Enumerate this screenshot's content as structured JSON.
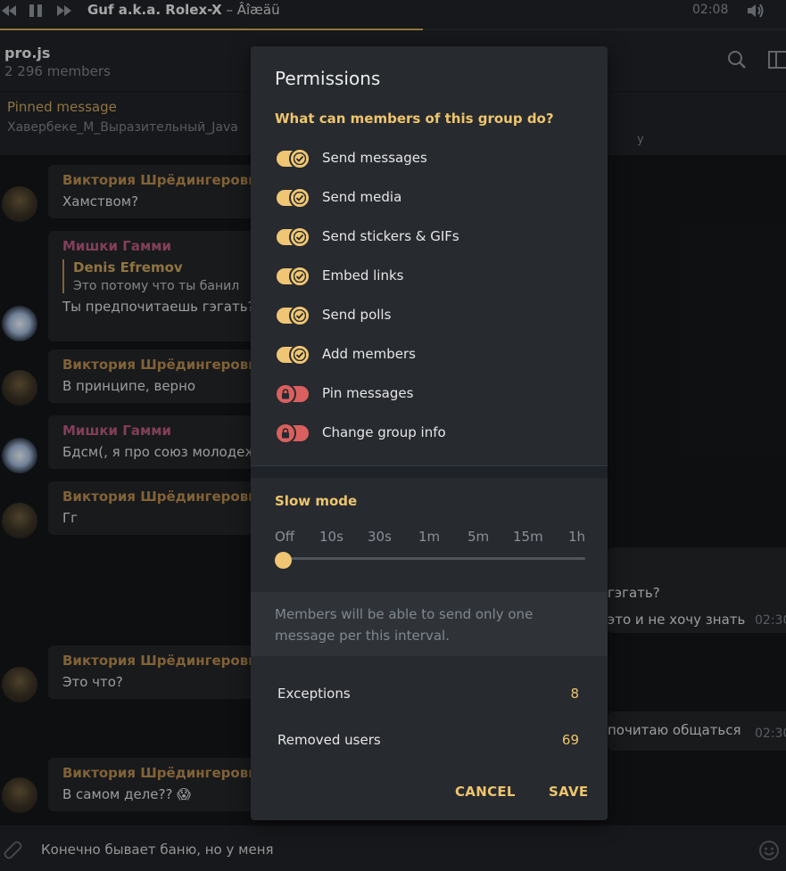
{
  "player": {
    "title": "Guf a.k.a. Rolex-X",
    "subtitle": " – Âîæäü",
    "time": "02:08"
  },
  "header": {
    "title": "pro.js",
    "subtitle": "2 296 members"
  },
  "pinned": {
    "label": "Pinned message",
    "text": "Хавербеке_М_Выразительный_Java",
    "right": "у"
  },
  "messages": [
    {
      "author": "Виктория Шрёдингеровна",
      "text": "Хамством?"
    },
    {
      "author": "Мишки Гамми",
      "reply_author": "Denis Efremov",
      "reply_text": "Это потому что ты банил",
      "text": "Ты предпочитаешь гэгать?"
    },
    {
      "author": "Виктория Шрёдингеровна",
      "text": "В принципе, верно"
    },
    {
      "author": "Мишки Гамми",
      "text": "Бдсм(, я про союз молодеж"
    },
    {
      "author": "Виктория Шрёдингеровна",
      "text": "Гг"
    },
    {
      "author": "Виктория Шрёдингеровна",
      "text": "Это что?"
    },
    {
      "author": "Виктория Шрёдингеровна",
      "text": "В самом деле?? 😱"
    }
  ],
  "right_messages": [
    {
      "text": "гэгать?",
      "time": ""
    },
    {
      "text": "это и не хочу знать",
      "time": "02:30"
    },
    {
      "text": "почитаю общаться",
      "time": "02:30"
    }
  ],
  "composer": {
    "text": "Конечно бывает баню, но у меня"
  },
  "dialog": {
    "title": "Permissions",
    "question": "What can members of this group do?",
    "permissions": [
      {
        "label": "Send messages",
        "enabled": true
      },
      {
        "label": "Send media",
        "enabled": true
      },
      {
        "label": "Send stickers & GIFs",
        "enabled": true
      },
      {
        "label": "Embed links",
        "enabled": true
      },
      {
        "label": "Send polls",
        "enabled": true
      },
      {
        "label": "Add members",
        "enabled": true
      },
      {
        "label": "Pin messages",
        "enabled": false
      },
      {
        "label": "Change group info",
        "enabled": false
      }
    ],
    "slow_mode": {
      "title": "Slow mode",
      "options": [
        "Off",
        "10s",
        "30s",
        "1m",
        "5m",
        "15m",
        "1h"
      ],
      "selected": "Off"
    },
    "info": "Members will be able to send only one message per this interval.",
    "exceptions": {
      "label": "Exceptions",
      "value": "8"
    },
    "removed": {
      "label": "Removed users",
      "value": "69"
    },
    "cancel": "CANCEL",
    "save": "SAVE"
  },
  "colors": {
    "accent": "#eec56d",
    "toggle_on": "#f0c674",
    "toggle_off": "#d9605e",
    "dialog_bg": "#272a2f"
  }
}
